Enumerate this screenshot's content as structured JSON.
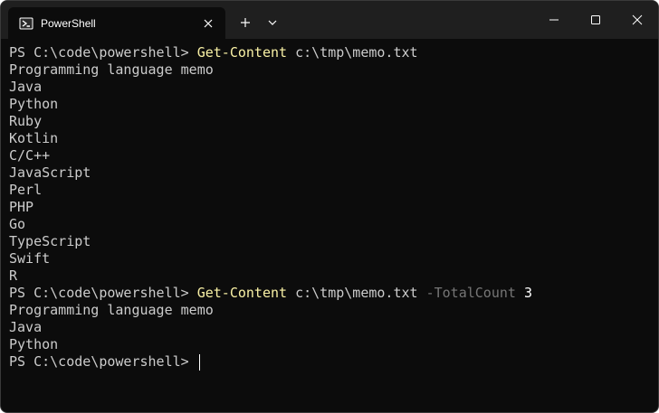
{
  "window": {
    "tab_title": "PowerShell",
    "tab_icon": "powershell-icon",
    "new_tab_icon": "plus-icon",
    "dropdown_icon": "chevron-down-icon",
    "minimize_icon": "minimize-icon",
    "maximize_icon": "maximize-icon",
    "close_icon": "close-icon"
  },
  "colors": {
    "background": "#0c0c0c",
    "titlebar": "#1f1f1f",
    "text": "#cccccc",
    "command": "#f9f1a5",
    "parameter": "#767676"
  },
  "terminal": {
    "prompt": "PS C:\\code\\powershell> ",
    "command1": {
      "cmdlet": "Get-Content",
      "args": " c:\\tmp\\memo.txt"
    },
    "output1": [
      "Programming language memo",
      "Java",
      "Python",
      "Ruby",
      "Kotlin",
      "C/C++",
      "JavaScript",
      "Perl",
      "PHP",
      "Go",
      "TypeScript",
      "Swift",
      "R"
    ],
    "command2": {
      "cmdlet": "Get-Content",
      "args": " c:\\tmp\\memo.txt ",
      "param": "-TotalCount",
      "value": " 3"
    },
    "output2": [
      "Programming language memo",
      "Java",
      "Python"
    ]
  }
}
